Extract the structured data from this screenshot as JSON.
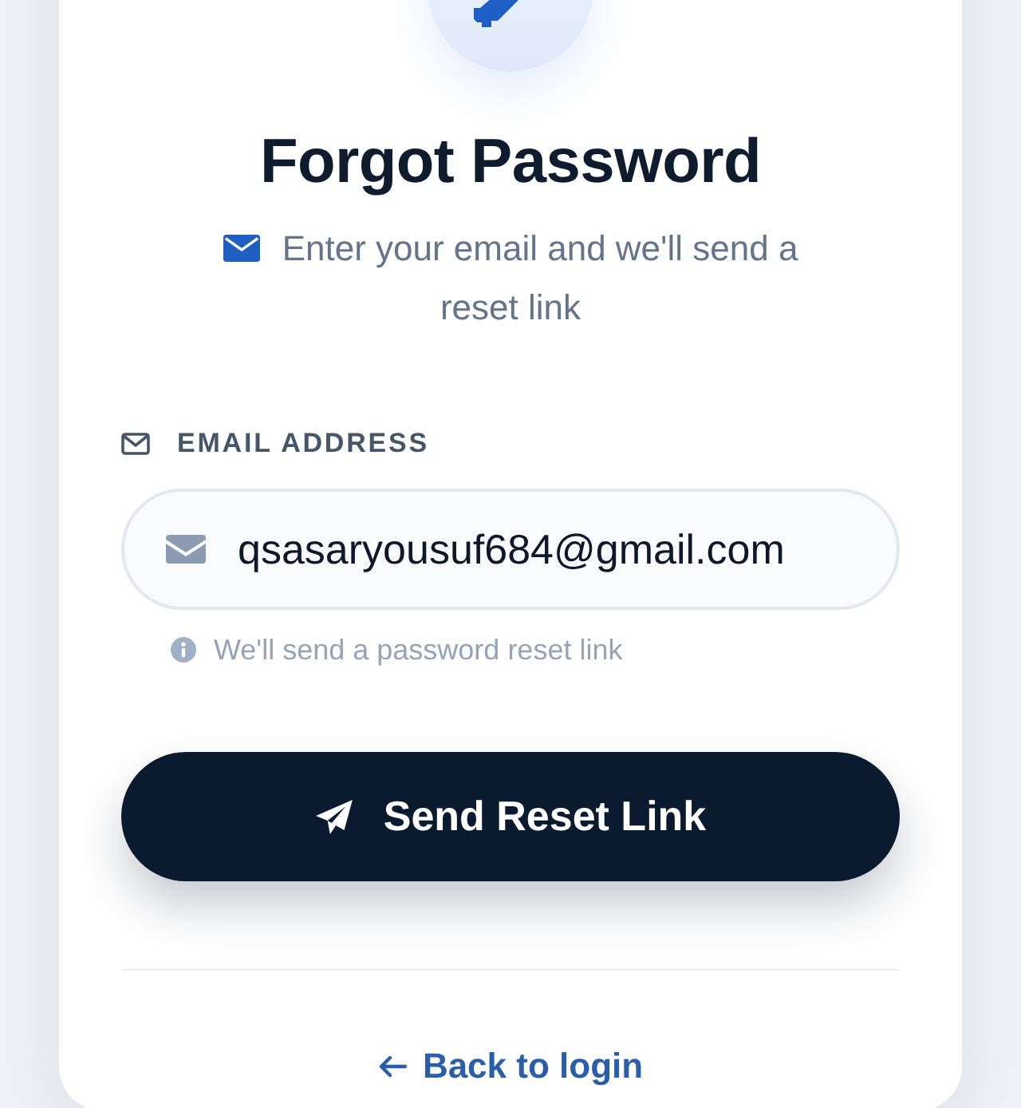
{
  "header": {
    "title": "Forgot Password",
    "subtitle": "Enter your email and we'll send a reset link"
  },
  "email_field": {
    "label": "EMAIL ADDRESS",
    "value": "qsasaryousuf684@gmail.com",
    "hint": "We'll send a password reset link"
  },
  "submit_button": {
    "label": "Send Reset Link"
  },
  "back_link": {
    "label": "Back to login"
  }
}
